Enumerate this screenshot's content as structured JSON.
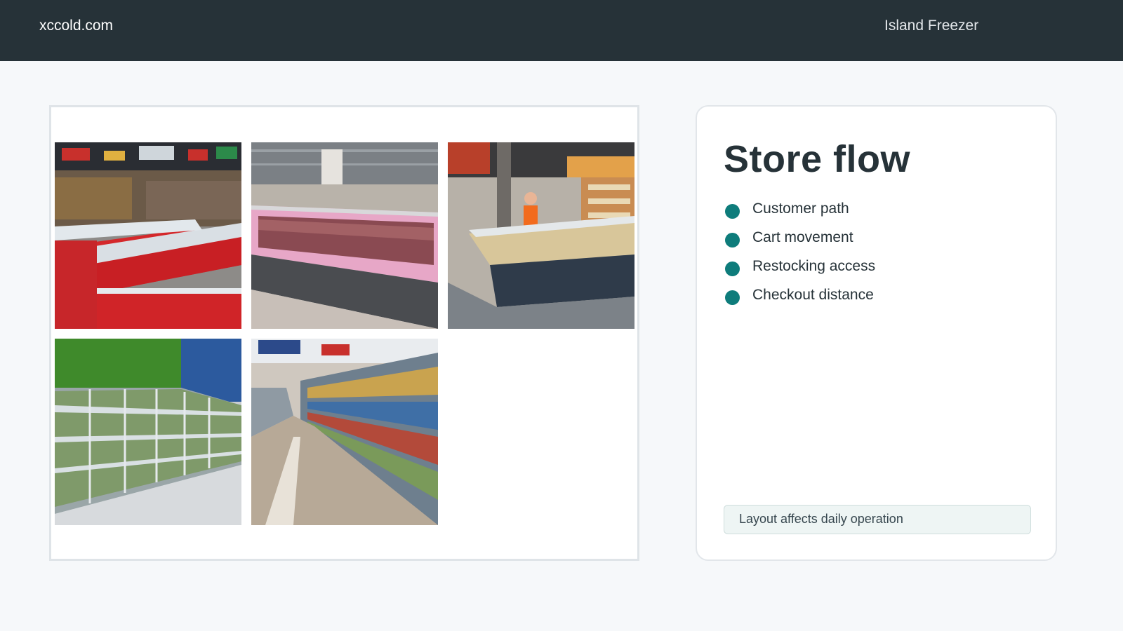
{
  "header": {
    "site_name": "xccold.com",
    "page_title": "Island Freezer",
    "background_color": "#263238"
  },
  "gallery": {
    "photos": [
      {
        "subject": "red island freezers in supermarket aisle"
      },
      {
        "subject": "open meat display case with pink lighting"
      },
      {
        "subject": "deli service counter with glass front"
      },
      {
        "subject": "glass door upright coolers with produce"
      },
      {
        "subject": "long supermarket aisle with shelves"
      }
    ]
  },
  "panel": {
    "title": "Store flow",
    "items": [
      {
        "label": "Customer path"
      },
      {
        "label": "Cart movement"
      },
      {
        "label": "Restocking access"
      },
      {
        "label": "Checkout distance"
      }
    ],
    "note": "Layout affects daily operation",
    "accent_color": "#0e7c7b"
  }
}
